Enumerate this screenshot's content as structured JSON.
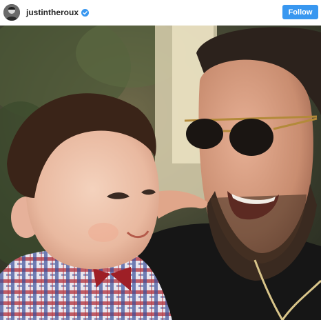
{
  "header": {
    "username": "justintheroux",
    "verified_icon": "verified-badge-icon",
    "follow_label": "Follow",
    "accent": "#3897f0"
  },
  "photo": {
    "description_icon": "post-photo"
  }
}
